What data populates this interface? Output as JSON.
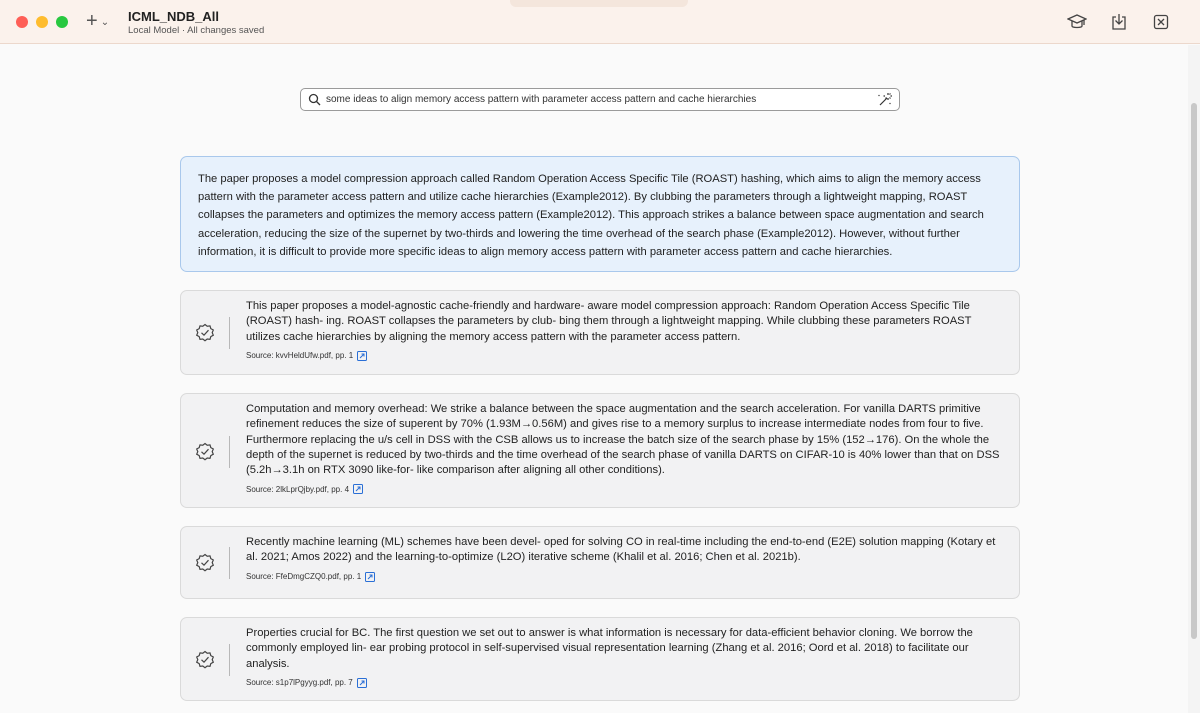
{
  "window": {
    "title": "ICML_NDB_All",
    "subtitle": "Local Model · All changes saved",
    "new_button_icon": "plus-icon",
    "toolbar_icons": [
      "graduation-cap-icon",
      "download-icon",
      "close-window-icon"
    ]
  },
  "search": {
    "query": "some ideas to align memory access pattern with parameter access pattern and cache hierarchies",
    "icon": "search-icon",
    "action_icon": "magic-wand-icon"
  },
  "summary": {
    "text": "The paper proposes a model compression approach called Random Operation Access Specific Tile (ROAST) hashing, which aims to align the memory access pattern with the parameter access pattern and utilize cache hierarchies (Example2012). By clubbing the parameters through a lightweight mapping, ROAST collapses the parameters and optimizes the memory access pattern (Example2012). This approach strikes a balance between space augmentation and search acceleration, reducing the size of the supernet by two-thirds and lowering the time overhead of the search phase (Example2012). However, without further information, it is difficult to provide more specific ideas to align memory access pattern with parameter access pattern and cache hierarchies."
  },
  "results": [
    {
      "text": "This paper proposes a model-agnostic cache-friendly and hardware- aware model compression approach: Random Operation Access Specific Tile (ROAST) hash- ing. ROAST collapses the parameters by club- bing them through a lightweight mapping. While clubbing these parameters ROAST utilizes cache hierarchies by aligning the memory access pattern with the parameter access pattern.",
      "source": "Source: kvvHeldUfw.pdf, pp. 1"
    },
    {
      "text": "Computation and memory overhead: We strike a balance between the space augmentation and the search acceleration. For vanilla DARTS primitive refinement reduces the size of superent by 70% (1.93M→0.56M) and gives rise to a memory surplus to increase intermediate nodes from four to five. Furthermore replacing the u/s cell in DSS with the CSB allows us to increase the batch size of the search phase by 15% (152→176). On the whole the depth of the supernet is reduced by two-thirds and the time overhead of the search phase of vanilla DARTS on CIFAR-10 is 40% lower than that on DSS (5.2h→3.1h on RTX 3090 like-for- like comparison after aligning all other conditions).",
      "source": "Source: 2lkLprQjby.pdf, pp. 4"
    },
    {
      "text": "Recently machine learning (ML) schemes have been devel- oped for solving CO in real-time including the end-to-end (E2E) solution mapping (Kotary et al. 2021; Amos 2022) and the learning-to-optimize (L2O) iterative scheme (Khalil et al. 2016; Chen et al. 2021b).",
      "source": "Source: FfeDmgCZQ0.pdf, pp. 1"
    },
    {
      "text": "Properties crucial for BC. The first question we set out to answer is what information is necessary for data-efficient behavior cloning. We borrow the commonly employed lin- ear probing protocol in self-supervised visual representation learning (Zhang et al. 2016; Oord et al. 2018) to facilitate our analysis.",
      "source": "Source: s1p7lPgyyg.pdf, pp. 7"
    }
  ],
  "colors": {
    "titlebar_bg": "#fbf2ec",
    "summary_bg": "#e7f1fc",
    "summary_border": "#a9c8ec",
    "card_bg": "#f2f2f3",
    "link_icon": "#2a6fd6"
  }
}
